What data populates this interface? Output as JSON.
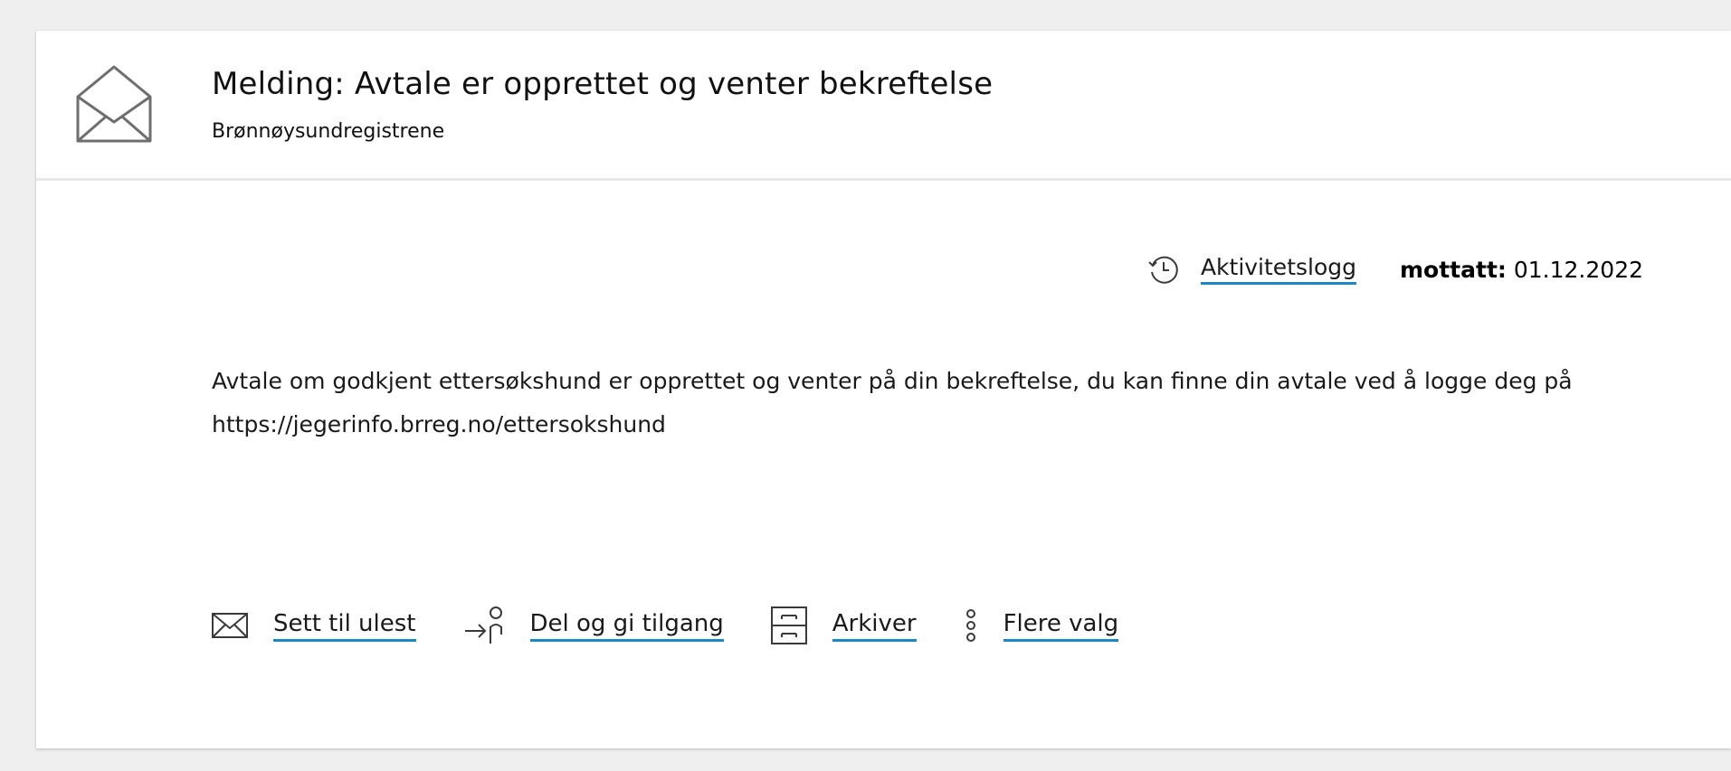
{
  "message": {
    "title": "Melding: Avtale er opprettet og venter bekreftelse",
    "sender": "Brønnøysundregistrene",
    "activity_log_label": "Aktivitetslogg",
    "received_label": "mottatt:",
    "received_date": "01.12.2022",
    "body": "Avtale om godkjent ettersøkshund er opprettet og venter på din bekreftelse, du kan finne din avtale ved å logge deg på https://jegerinfo.brreg.no/ettersokshund"
  },
  "actions": {
    "mark_unread": "Sett til ulest",
    "share": "Del og gi tilgang",
    "archive": "Arkiver",
    "more": "Flere valg"
  },
  "colors": {
    "link_underline": "#1b87c4",
    "background": "#efefef",
    "card": "#ffffff"
  },
  "icons": {
    "header": "envelope-open-icon",
    "activity": "history-clock-icon",
    "mark_unread": "envelope-icon",
    "share": "share-person-icon",
    "archive": "archive-drawer-icon",
    "more": "vertical-dots-icon"
  }
}
